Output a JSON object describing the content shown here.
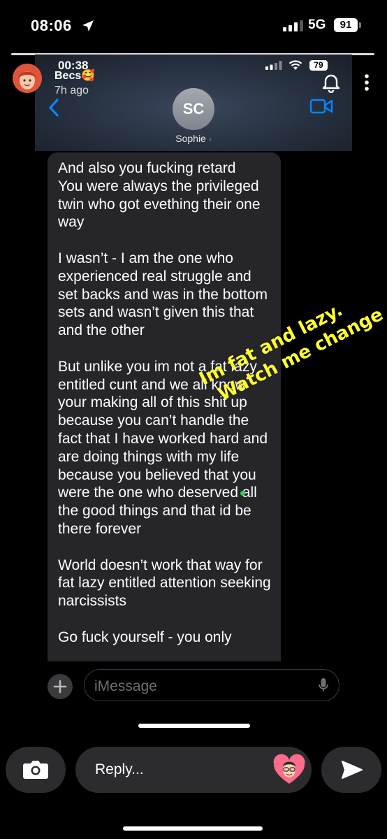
{
  "status_bar": {
    "time": "08:06",
    "network": "5G",
    "battery": "91"
  },
  "story": {
    "username": "Becs🥰",
    "age": "7h ago"
  },
  "screenshot": {
    "status_time": "00:38",
    "battery": "79",
    "contact_initials": "SC",
    "contact_name": "Sophie",
    "message": "And also you fucking retard\nYou were always the privileged twin who got evething their one way\n\nI wasn’t - I am the one who experienced real struggle and set backs and was in the bottom sets and wasn’t given this that and the other\n\nBut unlike you im not a fat lazy entitled cunt and we all know your making all of this shit up because you can’t handle the fact that I have worked hard and are doing things with my life because you believed that you were the one who deserved all the good things and that id be there forever\n\nWorld doesn’t work that way for fat lazy entitled attention seeking narcissists\n\nGo fuck yourself - you only",
    "input_placeholder": "iMessage"
  },
  "caption": {
    "line1": "Im fat and lazy.",
    "line2": "Watch me change"
  },
  "reply": {
    "placeholder": "Reply..."
  },
  "colors": {
    "caption": "#ffff2e",
    "bubble": "#26252a",
    "ios_blue": "#0a84ff"
  }
}
